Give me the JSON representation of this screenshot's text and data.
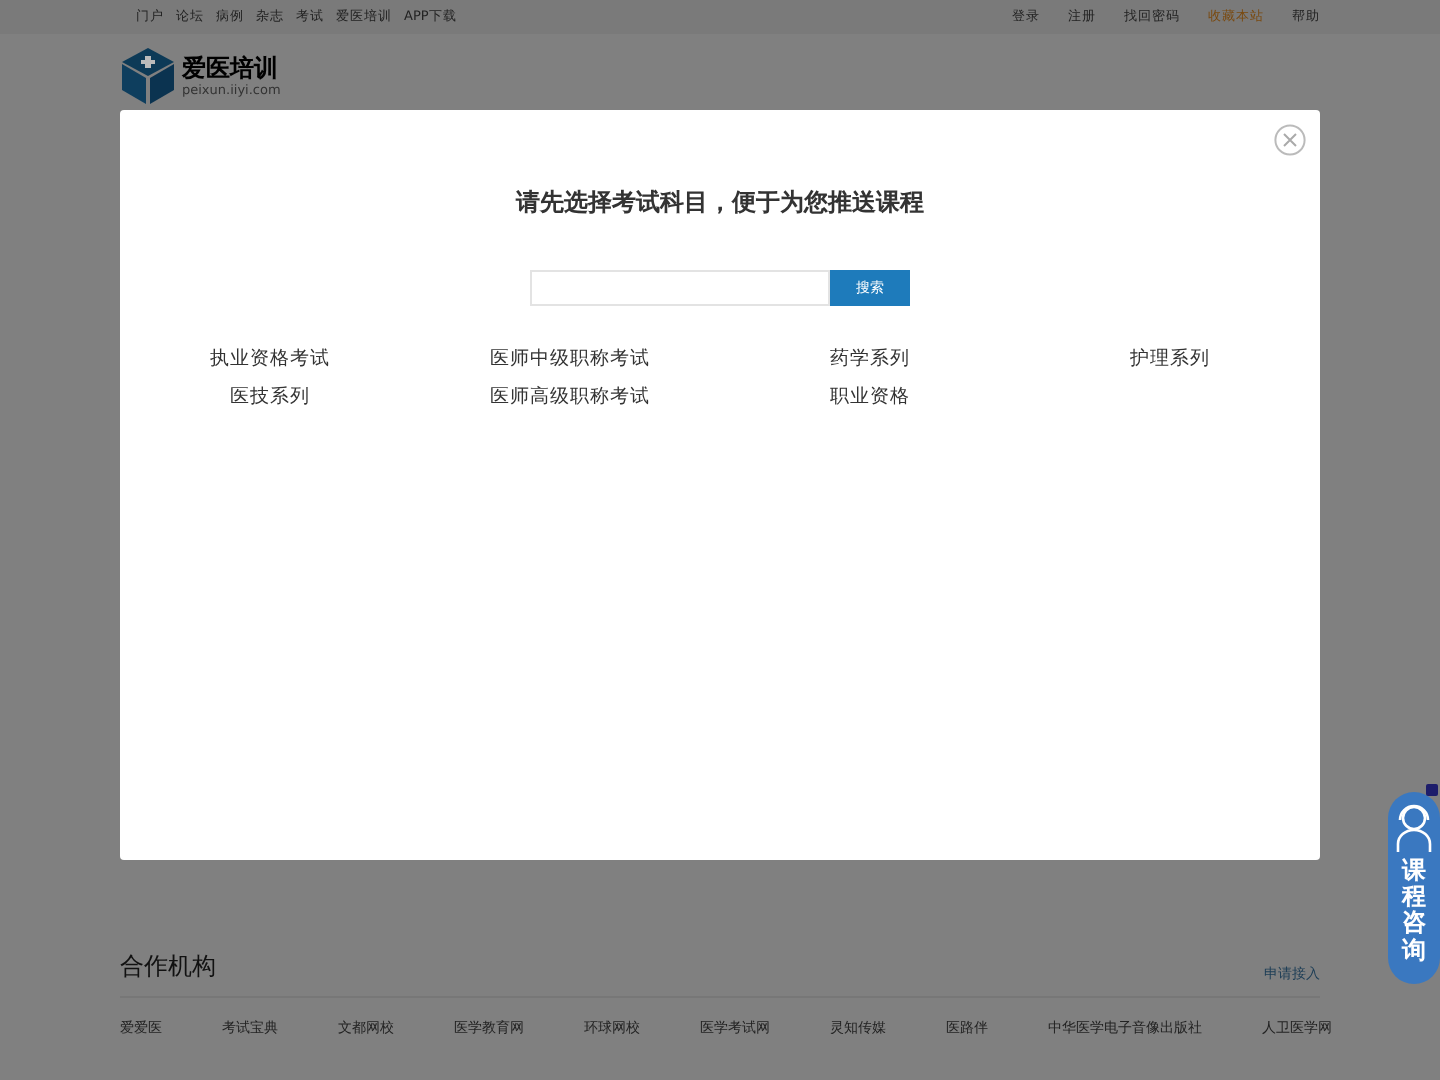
{
  "top_nav": {
    "left": [
      "门户",
      "论坛",
      "病例",
      "杂志",
      "考试",
      "爱医培训",
      "APP下载"
    ],
    "right": [
      {
        "label": "登录",
        "highlighted": false
      },
      {
        "label": "注册",
        "highlighted": false
      },
      {
        "label": "找回密码",
        "highlighted": false
      },
      {
        "label": "收藏本站",
        "highlighted": true
      },
      {
        "label": "帮助",
        "highlighted": false
      }
    ]
  },
  "logo": {
    "name": "爱医培训",
    "domain": "peixun.iiyi.com"
  },
  "modal": {
    "title": "请先选择考试科目，便于为您推送课程",
    "search_button": "搜索",
    "subjects": [
      "执业资格考试",
      "医师中级职称考试",
      "药学系列",
      "护理系列",
      "医技系列",
      "医师高级职称考试",
      "职业资格"
    ]
  },
  "partners": {
    "title": "合作机构",
    "apply_link": "申请接入",
    "items": [
      "爱爱医",
      "考试宝典",
      "文都网校",
      "医学教育网",
      "环球网校",
      "医学考试网",
      "灵知传媒",
      "医路伴",
      "中华医学电子音像出版社",
      "人卫医学网"
    ]
  },
  "side_float": {
    "label": "课程咨询"
  }
}
